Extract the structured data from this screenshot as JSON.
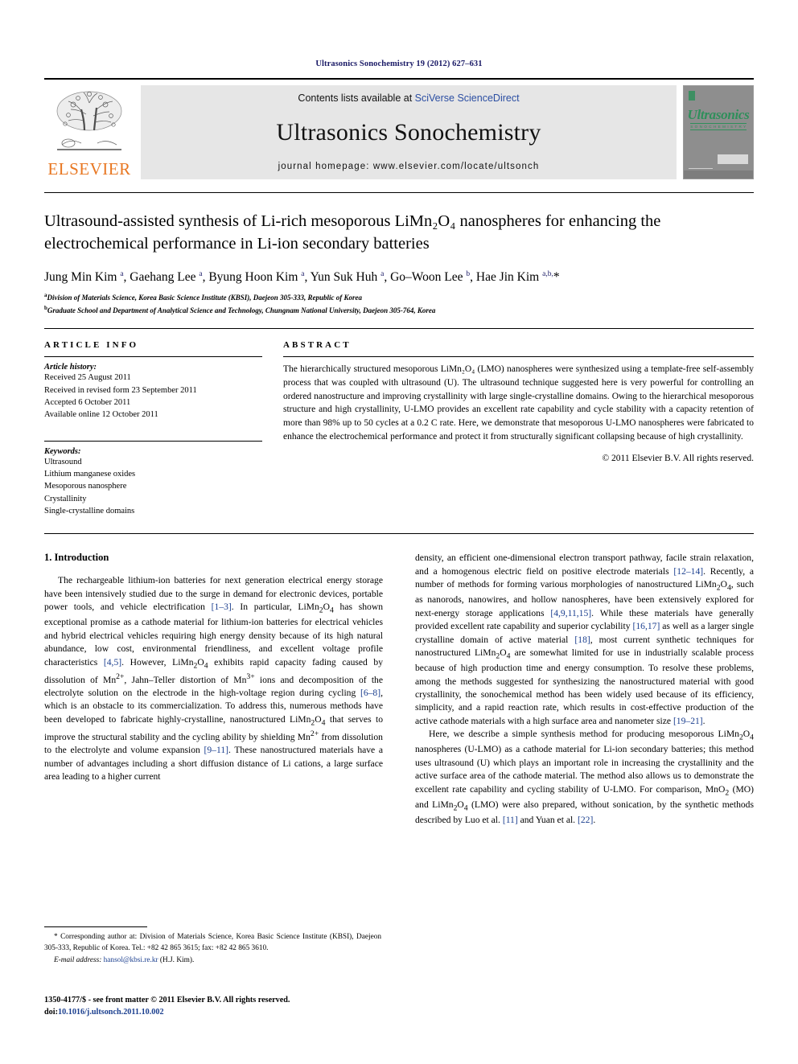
{
  "running_head": "Ultrasonics Sonochemistry 19 (2012) 627–631",
  "masthead": {
    "publisher_name": "ELSEVIER",
    "contents_prefix": "Contents lists available at ",
    "contents_link": "SciVerse ScienceDirect",
    "journal_title": "Ultrasonics Sonochemistry",
    "journal_homepage": "journal homepage: www.elsevier.com/locate/ultsonch",
    "cover": {
      "title": "Ultrasonics",
      "subtitle": "S O N O C H E M I S T R Y"
    }
  },
  "article": {
    "title": "Ultrasound-assisted synthesis of Li-rich mesoporous LiMn₂O₄ nanospheres for enhancing the electrochemical performance in Li-ion secondary batteries",
    "authors_html": "Jung Min Kim <sup>a</sup>, Gaehang Lee <sup>a</sup>, Byung Hoon Kim <sup>a</sup>, Yun Suk Huh <sup>a</sup>, Go–Woon Lee <sup>b</sup>, Hae Jin Kim <sup>a,b,</sup>*",
    "affiliations": [
      "Division of Materials Science, Korea Basic Science Institute (KBSI), Daejeon 305-333, Republic of Korea",
      "Graduate School and Department of Analytical Science and Technology, Chungnam National University, Daejeon 305-764, Korea"
    ],
    "affiliation_marks": [
      "a",
      "b"
    ]
  },
  "article_info": {
    "heading": "ARTICLE INFO",
    "history_label": "Article history:",
    "history": [
      "Received 25 August 2011",
      "Received in revised form 23 September 2011",
      "Accepted 6 October 2011",
      "Available online 12 October 2011"
    ],
    "keywords_label": "Keywords:",
    "keywords": [
      "Ultrasound",
      "Lithium manganese oxides",
      "Mesoporous nanosphere",
      "Crystallinity",
      "Single-crystalline domains"
    ]
  },
  "abstract": {
    "heading": "ABSTRACT",
    "text": "The hierarchically structured mesoporous LiMn₂O₄ (LMO) nanospheres were synthesized using a template-free self-assembly process that was coupled with ultrasound (U). The ultrasound technique suggested here is very powerful for controlling an ordered nanostructure and improving crystallinity with large single-crystalline domains. Owing to the hierarchical mesoporous structure and high crystallinity, U-LMO provides an excellent rate capability and cycle stability with a capacity retention of more than 98% up to 50 cycles at a 0.2 C rate. Here, we demonstrate that mesoporous U-LMO nanospheres were fabricated to enhance the electrochemical performance and protect it from structurally significant collapsing because of high crystallinity.",
    "copyright": "© 2011 Elsevier B.V. All rights reserved."
  },
  "body": {
    "section_title": "1. Introduction",
    "left_paragraph_html": "The rechargeable lithium-ion batteries for next generation electrical energy storage have been intensively studied due to the surge in demand for electronic devices, portable power tools, and vehicle electrification <span class=\"cit\">[1–3]</span>. In particular, LiMn<sub>2</sub>O<sub>4</sub> has shown exceptional promise as a cathode material for lithium-ion batteries for electrical vehicles and hybrid electrical vehicles requiring high energy density because of its high natural abundance, low cost, environmental friendliness, and excellent voltage profile characteristics <span class=\"cit\">[4,5]</span>. However, LiMn<sub>2</sub>O<sub>4</sub> exhibits rapid capacity fading caused by dissolution of Mn<sup>2+</sup>, Jahn–Teller distortion of Mn<sup>3+</sup> ions and decomposition of the electrolyte solution on the electrode in the high-voltage region during cycling <span class=\"cit\">[6–8]</span>, which is an obstacle to its commercialization. To address this, numerous methods have been developed to fabricate highly-crystalline, nanostructured LiMn<sub>2</sub>O<sub>4</sub> that serves to improve the structural stability and the cycling ability by shielding Mn<sup>2+</sup> from dissolution to the electrolyte and volume expansion <span class=\"cit\">[9–11]</span>. These nanostructured materials have a number of advantages including a short diffusion distance of Li cations, a large surface area leading to a higher current",
    "right_paragraph_1_html": "density, an efficient one-dimensional electron transport pathway, facile strain relaxation, and a homogenous electric field on positive electrode materials <span class=\"cit\">[12–14]</span>. Recently, a number of methods for forming various morphologies of nanostructured LiMn<sub>2</sub>O<sub>4</sub>, such as nanorods, nanowires, and hollow nanospheres, have been extensively explored for next-energy storage applications <span class=\"cit\">[4,9,11,15]</span>. While these materials have generally provided excellent rate capability and superior cyclability <span class=\"cit\">[16,17]</span> as well as a larger single crystalline domain of active material <span class=\"cit\">[18]</span>, most current synthetic techniques for nanostructured LiMn<sub>2</sub>O<sub>4</sub> are somewhat limited for use in industrially scalable process because of high production time and energy consumption. To resolve these problems, among the methods suggested for synthesizing the nanostructured material with good crystallinity, the sonochemical method has been widely used because of its efficiency, simplicity, and a rapid reaction rate, which results in cost-effective production of the active cathode materials with a high surface area and nanometer size <span class=\"cit\">[19–21]</span>.",
    "right_paragraph_2_html": "Here, we describe a simple synthesis method for producing mesoporous LiMn<sub>2</sub>O<sub>4</sub> nanospheres (U-LMO) as a cathode material for Li-ion secondary batteries; this method uses ultrasound (U) which plays an important role in increasing the crystallinity and the active surface area of the cathode material. The method also allows us to demonstrate the excellent rate capability and cycling stability of U-LMO. For comparison, MnO<sub>2</sub> (MO) and LiMn<sub>2</sub>O<sub>4</sub> (LMO) were also prepared, without sonication, by the synthetic methods described by Luo et al. <span class=\"cit\">[11]</span> and Yuan et al. <span class=\"cit\">[22]</span>."
  },
  "footnote": {
    "text": "* Corresponding author at: Division of Materials Science, Korea Basic Science Institute (KBSI), Daejeon 305-333, Republic of Korea. Tel.: +82 42 865 3615; fax: +82 42 865 3610.",
    "email_label": "E-mail address:",
    "email": "hansol@kbsi.re.kr",
    "email_owner": "(H.J. Kim)."
  },
  "footer": {
    "line1": "1350-4177/$ - see front matter © 2011 Elsevier B.V. All rights reserved.",
    "doi_label": "doi:",
    "doi": "10.1016/j.ultsonch.2011.10.002"
  },
  "colors": {
    "link_blue": "#1b3f8f",
    "elsevier_orange": "#E87722",
    "cover_green": "#2f8f5b",
    "banner_gray": "#e6e6e6"
  }
}
